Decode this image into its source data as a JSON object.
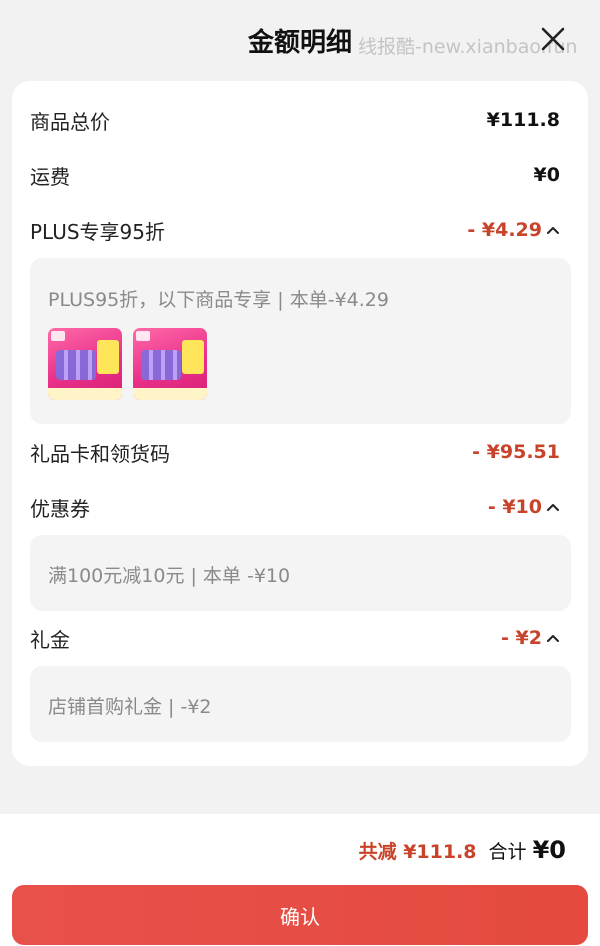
{
  "header": {
    "title": "金额明细",
    "watermark": "线报酷-new.xianbao.fun"
  },
  "rows": {
    "goods_total": {
      "label": "商品总价",
      "amount": "¥111.8"
    },
    "shipping": {
      "label": "运费",
      "amount": "¥0"
    },
    "plus": {
      "label": "PLUS专享95折",
      "amount": "- ¥4.29",
      "detail": "PLUS95折，以下商品专享 | 本单-¥4.29"
    },
    "gift_card": {
      "label": "礼品卡和领货码",
      "amount": "- ¥95.51"
    },
    "coupon": {
      "label": "优惠券",
      "amount": "- ¥10",
      "detail": "满100元减10元 | 本单 -¥10"
    },
    "cash_gift": {
      "label": "礼金",
      "amount": "- ¥2",
      "detail": "店铺首购礼金 | -¥2"
    }
  },
  "products": [
    {
      "name": "product-thumb-1"
    },
    {
      "name": "product-thumb-2"
    }
  ],
  "footer": {
    "saved": "共减 ¥111.8",
    "total_label": "合计",
    "total_value": "¥0",
    "confirm_label": "确认"
  },
  "colors": {
    "accent_red": "#c8432a",
    "button_red": "#e44a3f"
  }
}
